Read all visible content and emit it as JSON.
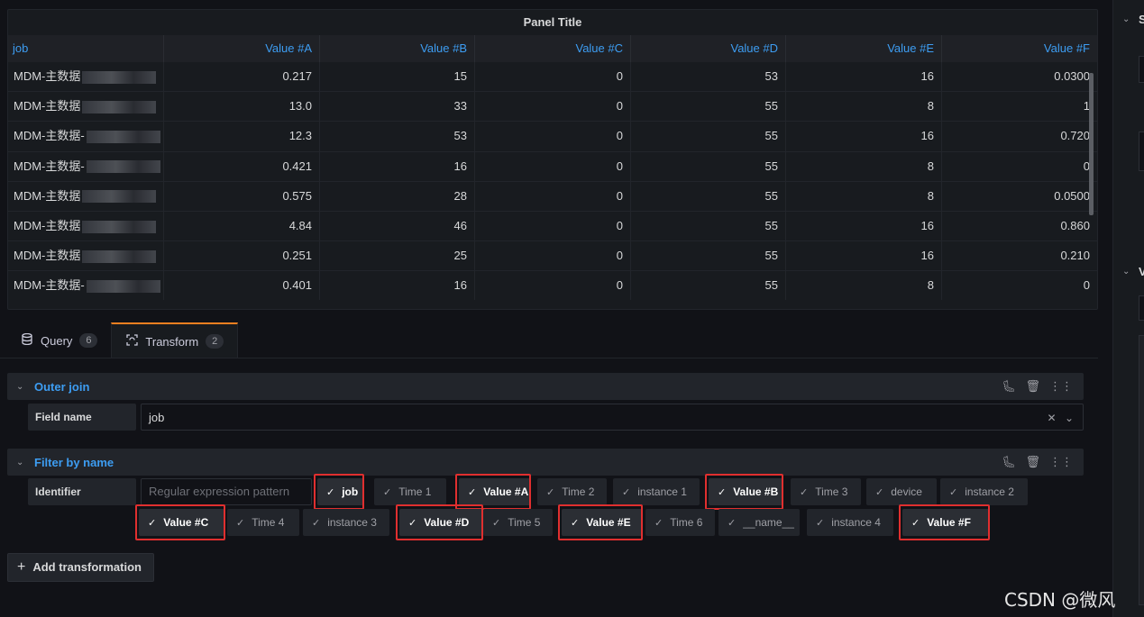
{
  "panel": {
    "title": "Panel Title",
    "columns": [
      "job",
      "Value #A",
      "Value #B",
      "Value #C",
      "Value #D",
      "Value #E",
      "Value #F"
    ],
    "rows": [
      {
        "job": "MDM-主数据",
        "a": "0.217",
        "b": "15",
        "c": "0",
        "d": "53",
        "e": "16",
        "f": "0.0300"
      },
      {
        "job": "MDM-主数据",
        "a": "13.0",
        "b": "33",
        "c": "0",
        "d": "55",
        "e": "8",
        "f": "1"
      },
      {
        "job": "MDM-主数据-",
        "a": "12.3",
        "b": "53",
        "c": "0",
        "d": "55",
        "e": "16",
        "f": "0.720"
      },
      {
        "job": "MDM-主数据-",
        "a": "0.421",
        "b": "16",
        "c": "0",
        "d": "55",
        "e": "8",
        "f": "0"
      },
      {
        "job": "MDM-主数据",
        "a": "0.575",
        "b": "28",
        "c": "0",
        "d": "55",
        "e": "8",
        "f": "0.0500"
      },
      {
        "job": "MDM-主数据",
        "a": "4.84",
        "b": "46",
        "c": "0",
        "d": "55",
        "e": "16",
        "f": "0.860"
      },
      {
        "job": "MDM-主数据",
        "a": "0.251",
        "b": "25",
        "c": "0",
        "d": "55",
        "e": "16",
        "f": "0.210"
      },
      {
        "job": "MDM-主数据-",
        "a": "0.401",
        "b": "16",
        "c": "0",
        "d": "55",
        "e": "8",
        "f": "0"
      }
    ]
  },
  "tabs": [
    {
      "label": "Query",
      "count": "6",
      "icon": "database-icon"
    },
    {
      "label": "Transform",
      "count": "2",
      "icon": "transform-icon"
    }
  ],
  "outer_join": {
    "title": "Outer join",
    "field_label": "Field name",
    "field_value": "job"
  },
  "filter_by_name": {
    "title": "Filter by name",
    "identifier_label": "Identifier",
    "regex_placeholder": "Regular expression pattern",
    "chips": [
      {
        "label": "job",
        "selected": true
      },
      {
        "label": "Time 1",
        "selected": false
      },
      {
        "label": "Value #A",
        "selected": true
      },
      {
        "label": "Time 2",
        "selected": false
      },
      {
        "label": "instance 1",
        "selected": false
      },
      {
        "label": "Value #B",
        "selected": true
      },
      {
        "label": "Time 3",
        "selected": false
      },
      {
        "label": "device",
        "selected": false
      },
      {
        "label": "instance 2",
        "selected": false
      },
      {
        "label": "Value #C",
        "selected": true
      },
      {
        "label": "Time 4",
        "selected": false
      },
      {
        "label": "instance 3",
        "selected": false
      },
      {
        "label": "Value #D",
        "selected": true
      },
      {
        "label": "Time 5",
        "selected": false
      },
      {
        "label": "Value #E",
        "selected": true
      },
      {
        "label": "Time 6",
        "selected": false
      },
      {
        "label": "__name__",
        "selected": false
      },
      {
        "label": "instance 4",
        "selected": false
      },
      {
        "label": "Value #F",
        "selected": true
      }
    ]
  },
  "add_transformation": "Add transformation",
  "right_letters": {
    "s": "S",
    "v": "V"
  },
  "watermark": "CSDN @微风"
}
